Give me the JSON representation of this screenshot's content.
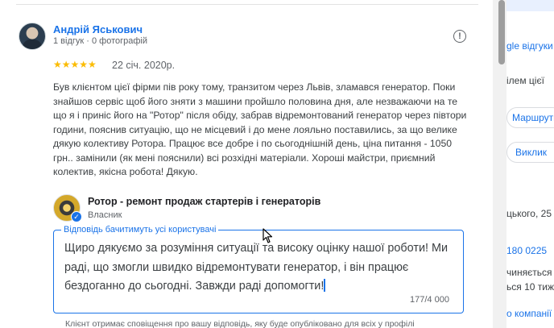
{
  "review": {
    "author_name": "Андрій Яськович",
    "author_meta": "1 відгук · 0 фотографій",
    "stars": "★★★★★",
    "rating": 5,
    "date": "22 січ. 2020р.",
    "text": "Був клієнтом цієї фірми пів року тому, транзитом через Львів, зламався генератор. Поки знайшов сервіс щоб його зняти з машини пройшло половина дня, але незважаючи на те що я і приніс його на \"Ротор\" після обіду, забрав відремонтований генератор через півтори години, пояснив ситуацію, що не місцевий і до мене лояльно поставились, за що велике дякую колективу Ротора. Працює все добре і по сьогоднішній день, ціна питання - 1050 грн.. замінили (як мені пояснили) всі розхідні матеріали. Хороші майстри, приємний колектив, якісна робота! Дякую.",
    "flag_icon": "!"
  },
  "owner": {
    "name": "Ротор - ремонт продаж стартерів і генераторів",
    "role": "Власник",
    "verified_icon": "✓"
  },
  "reply": {
    "label": "Відповідь бачитимуть усі користувачі",
    "text": "Щиро дякуємо за розуміння ситуації та високу оцінку нашої роботи! Ми раді, що змогли швидко відремонтувати генератор, і він працює бездоганно до сьогодні. Завжди раді допомогти!",
    "char_count": "177/4 000",
    "note": "Клієнт отримає сповіщення про вашу відповідь, яку буде опубліковано для всіх у профілі"
  },
  "side": {
    "line1": "gle відгуки",
    "line2": "ілем цієї",
    "route_button": "Маршрути",
    "call_button": "Виклик",
    "address": "цького, 25",
    "phone": "180 0225",
    "line3": "чиняється",
    "line4": "ься 10 тиж",
    "line5": "о компанії"
  },
  "colors": {
    "accent": "#1a73e8",
    "stars": "#fbbc04",
    "text": "#3c4043"
  }
}
